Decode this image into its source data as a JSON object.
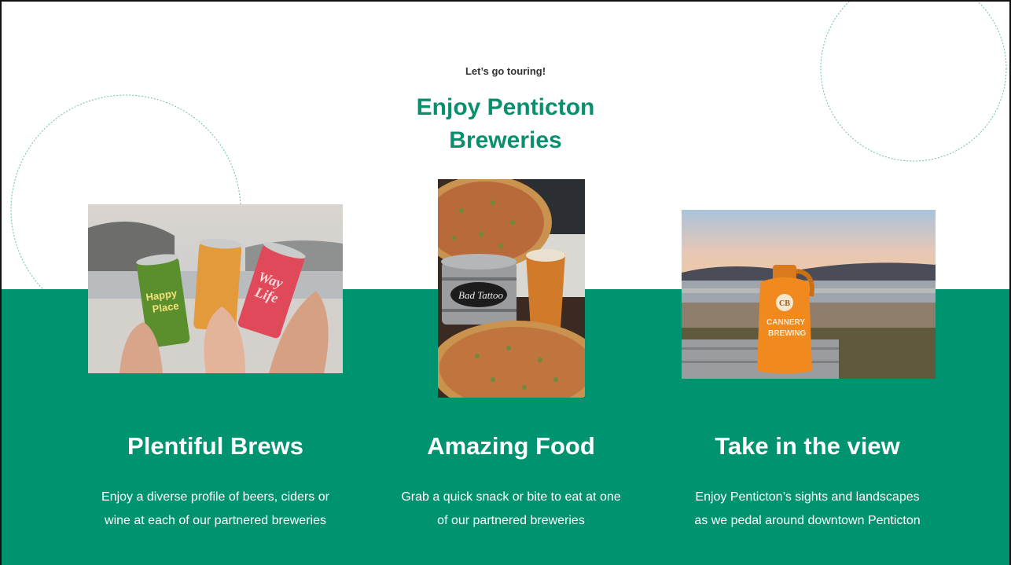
{
  "hero": {
    "kicker": "Let’s go touring!",
    "headline_line1": "Enjoy Penticton",
    "headline_line2": "Breweries"
  },
  "colors": {
    "brand_green": "#00936f",
    "headline_green": "#0a8f6e",
    "kicker_text": "#333333"
  },
  "cards": [
    {
      "title": "Plentiful Brews",
      "text_line1": "Enjoy a diverse profile of beers, ciders or",
      "text_line2": "wine at each of our partnered breweries",
      "can_labels": [
        "Happy Place",
        "",
        "Way Life"
      ]
    },
    {
      "title": "Amazing Food",
      "text_line1": "Grab a quick snack or bite to eat at one",
      "text_line2": "of our partnered breweries",
      "bucket_label": "Bad Tattoo"
    },
    {
      "title": "Take in the view",
      "text_line1": "Enjoy Penticton’s sights and landscapes",
      "text_line2": "as we pedal around downtown Penticton",
      "growler_label_1": "CANNERY",
      "growler_label_2": "BREWING",
      "growler_logo": "CB"
    }
  ]
}
